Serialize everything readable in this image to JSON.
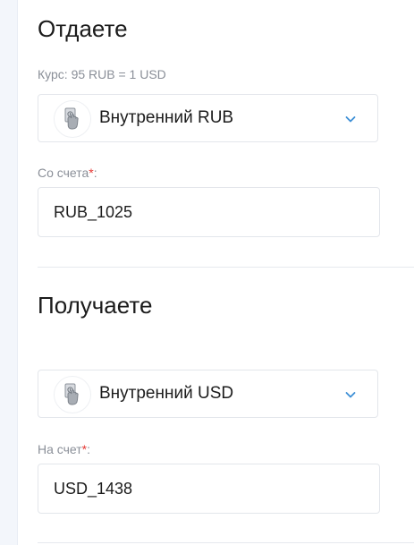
{
  "give": {
    "title": "Отдаете",
    "rate": "Курс: 95 RUB = 1 USD",
    "method": {
      "label": "Внутренний RUB",
      "icon": "cash-hand-icon"
    },
    "account": {
      "label": "Со счета",
      "required_mark": "*",
      "value": "RUB_1025"
    }
  },
  "receive": {
    "title": "Получаете",
    "method": {
      "label": "Внутренний USD",
      "icon": "cash-hand-icon"
    },
    "account": {
      "label": "На счет",
      "required_mark": "*",
      "value": "USD_1438"
    }
  },
  "colors": {
    "accent_chevron": "#3d8fd6",
    "required": "#e53935",
    "muted_text": "#8a8f98",
    "border": "#e3e6eb"
  }
}
